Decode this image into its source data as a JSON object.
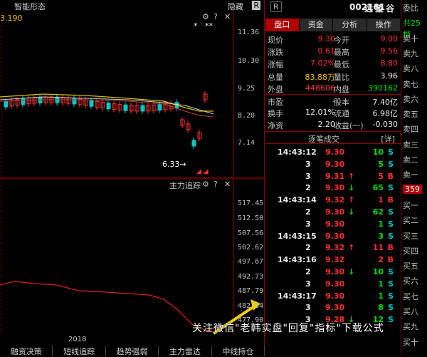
{
  "chart": {
    "title": "智能形态",
    "hide_label": "隐藏",
    "close_label": "R",
    "price_label": "3.190",
    "star1": "*",
    "star2": "**",
    "y_ticks": [
      "11.36",
      "10.30",
      "9.25",
      "8.20",
      "7.14"
    ],
    "low_label": "6.33",
    "sub_title": "主力追踪",
    "sub_ticks": [
      "517.45",
      "512.50",
      "507.56",
      "502.62",
      "497.67",
      "492.73",
      "487.79",
      "482.84",
      "477.90"
    ],
    "year": "2018",
    "bottom_tabs": [
      "融资决策",
      "短线追踪",
      "趋势强弱",
      "主力雷达",
      "中线持仓"
    ]
  },
  "right": {
    "r_key": "R",
    "code": "002161",
    "name": "远望谷",
    "tabs": [
      "盘口",
      "资金",
      "分析",
      "操作"
    ],
    "quote": [
      {
        "l1": "现价",
        "v1": "9.30",
        "c1": "red",
        "l2": "今开",
        "v2": "9.00",
        "c2": "red"
      },
      {
        "l1": "涨跌",
        "v1": "0.61",
        "c1": "red",
        "l2": "最高",
        "v2": "9.56",
        "c2": "red"
      },
      {
        "l1": "涨幅",
        "v1": "7.02%",
        "c1": "red",
        "l2": "最低",
        "v2": "8.80",
        "c2": "red"
      },
      {
        "l1": "总量",
        "v1": "83.88万",
        "c1": "yellow",
        "l2": "量比",
        "v2": "3.96",
        "c2": "white"
      },
      {
        "l1": "外盘",
        "v1": "448606",
        "c1": "red",
        "l2": "内盘",
        "v2": "390162",
        "c2": "green"
      },
      {
        "l1": "市盈",
        "v1": "-",
        "c1": "white",
        "l2": "股本",
        "v2": "7.40亿",
        "c2": "white"
      },
      {
        "l1": "换手",
        "v1": "12.01%",
        "c1": "white",
        "l2": "流通",
        "v2": "6.98亿",
        "c2": "white"
      },
      {
        "l1": "净资",
        "v1": "2.20",
        "c1": "white",
        "l2": "收益(一)",
        "v2": "-0.030",
        "c2": "white"
      }
    ],
    "ticks_title": "逐笔成交",
    "ticks_expand": "[详]",
    "ticks": [
      {
        "time": "14:43:12",
        "price": "9.30",
        "pc": "red",
        "arrow": "",
        "vol": "10",
        "side": "S"
      },
      {
        "time": "3",
        "price": "9.30",
        "pc": "red",
        "arrow": "",
        "vol": "5",
        "side": "S"
      },
      {
        "time": "3",
        "price": "9.31",
        "pc": "red",
        "arrow": "↑",
        "vol": "5",
        "side": "B"
      },
      {
        "time": "2",
        "price": "9.30",
        "pc": "red",
        "arrow": "↓",
        "vol": "65",
        "side": "S"
      },
      {
        "time": "14:43:14",
        "price": "9.32",
        "pc": "red",
        "arrow": "↑",
        "vol": "1",
        "side": "B"
      },
      {
        "time": "2",
        "price": "9.30",
        "pc": "red",
        "arrow": "↓",
        "vol": "62",
        "side": "S"
      },
      {
        "time": "3",
        "price": "9.30",
        "pc": "red",
        "arrow": "",
        "vol": "1",
        "side": "S"
      },
      {
        "time": "14:43:15",
        "price": "9.30",
        "pc": "red",
        "arrow": "",
        "vol": "3",
        "side": "S"
      },
      {
        "time": "2",
        "price": "9.32",
        "pc": "red",
        "arrow": "↑",
        "vol": "11",
        "side": "B"
      },
      {
        "time": "14:43:16",
        "price": "9.32",
        "pc": "red",
        "arrow": "",
        "vol": "2",
        "side": "B"
      },
      {
        "time": "2",
        "price": "9.30",
        "pc": "red",
        "arrow": "↓",
        "vol": "10",
        "side": "S"
      },
      {
        "time": "3",
        "price": "9.30",
        "pc": "red",
        "arrow": "",
        "vol": "1",
        "side": "S"
      },
      {
        "time": "14:43:17",
        "price": "9.30",
        "pc": "red",
        "arrow": "",
        "vol": "1",
        "side": "S"
      },
      {
        "time": "3",
        "price": "9.30",
        "pc": "red",
        "arrow": "",
        "vol": "8",
        "side": "S"
      },
      {
        "time": "3",
        "price": "9.28",
        "pc": "red",
        "arrow": "↓",
        "vol": "12",
        "side": "S"
      }
    ],
    "book": [
      "委比",
      "共25档",
      "卖十",
      "卖九",
      "卖八",
      "卖七",
      "卖六",
      "卖五",
      "卖四",
      "卖三",
      "卖二",
      "卖一",
      "359",
      "买一",
      "买二",
      "买三",
      "买四",
      "买五",
      "买六",
      "买七",
      "买八",
      "买九",
      "买十"
    ]
  },
  "watermark": "关注微信\"老韩实盘\"回复\"指标\"下载公式",
  "colors": {
    "up": "#ff3030",
    "down": "#00e000",
    "accent": "#b00000"
  }
}
